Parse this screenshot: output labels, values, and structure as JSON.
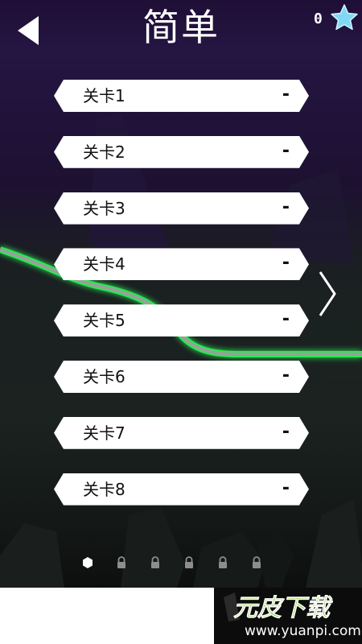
{
  "header": {
    "title": "简单",
    "star_count": "0"
  },
  "levels": [
    {
      "name": "关卡1",
      "score": "-"
    },
    {
      "name": "关卡2",
      "score": "-"
    },
    {
      "name": "关卡3",
      "score": "-"
    },
    {
      "name": "关卡4",
      "score": "-"
    },
    {
      "name": "关卡5",
      "score": "-"
    },
    {
      "name": "关卡6",
      "score": "-"
    },
    {
      "name": "关卡7",
      "score": "-"
    },
    {
      "name": "关卡8",
      "score": "-"
    }
  ],
  "pagination": {
    "total_pages": 6,
    "current_page": 1,
    "locked_pages": [
      2,
      3,
      4,
      5,
      6
    ]
  },
  "watermark": {
    "logo": "元皮下载",
    "url": "www.yuanpi.com"
  },
  "colors": {
    "background_top": "#1f0f36",
    "background_bottom": "#141817",
    "track_glow": "#2cff57",
    "star": "#7fd9f5",
    "watermark_green": "#7ec92a"
  }
}
